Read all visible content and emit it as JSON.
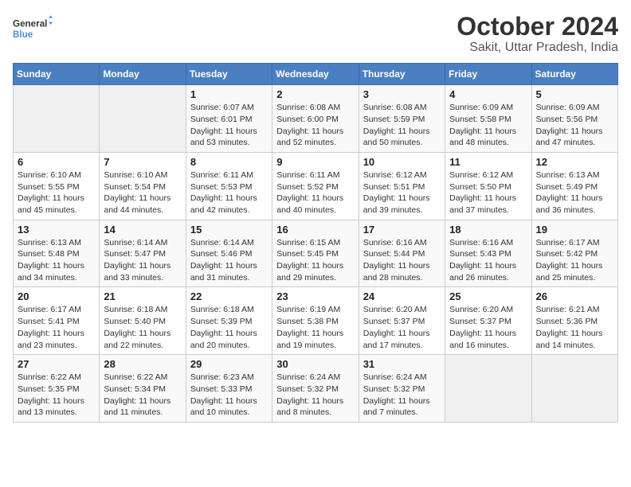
{
  "logo": {
    "text_general": "General",
    "text_blue": "Blue"
  },
  "title": "October 2024",
  "subtitle": "Sakit, Uttar Pradesh, India",
  "days_header": [
    "Sunday",
    "Monday",
    "Tuesday",
    "Wednesday",
    "Thursday",
    "Friday",
    "Saturday"
  ],
  "weeks": [
    [
      {
        "day": "",
        "info": ""
      },
      {
        "day": "",
        "info": ""
      },
      {
        "day": "1",
        "info": "Sunrise: 6:07 AM\nSunset: 6:01 PM\nDaylight: 11 hours and 53 minutes."
      },
      {
        "day": "2",
        "info": "Sunrise: 6:08 AM\nSunset: 6:00 PM\nDaylight: 11 hours and 52 minutes."
      },
      {
        "day": "3",
        "info": "Sunrise: 6:08 AM\nSunset: 5:59 PM\nDaylight: 11 hours and 50 minutes."
      },
      {
        "day": "4",
        "info": "Sunrise: 6:09 AM\nSunset: 5:58 PM\nDaylight: 11 hours and 48 minutes."
      },
      {
        "day": "5",
        "info": "Sunrise: 6:09 AM\nSunset: 5:56 PM\nDaylight: 11 hours and 47 minutes."
      }
    ],
    [
      {
        "day": "6",
        "info": "Sunrise: 6:10 AM\nSunset: 5:55 PM\nDaylight: 11 hours and 45 minutes."
      },
      {
        "day": "7",
        "info": "Sunrise: 6:10 AM\nSunset: 5:54 PM\nDaylight: 11 hours and 44 minutes."
      },
      {
        "day": "8",
        "info": "Sunrise: 6:11 AM\nSunset: 5:53 PM\nDaylight: 11 hours and 42 minutes."
      },
      {
        "day": "9",
        "info": "Sunrise: 6:11 AM\nSunset: 5:52 PM\nDaylight: 11 hours and 40 minutes."
      },
      {
        "day": "10",
        "info": "Sunrise: 6:12 AM\nSunset: 5:51 PM\nDaylight: 11 hours and 39 minutes."
      },
      {
        "day": "11",
        "info": "Sunrise: 6:12 AM\nSunset: 5:50 PM\nDaylight: 11 hours and 37 minutes."
      },
      {
        "day": "12",
        "info": "Sunrise: 6:13 AM\nSunset: 5:49 PM\nDaylight: 11 hours and 36 minutes."
      }
    ],
    [
      {
        "day": "13",
        "info": "Sunrise: 6:13 AM\nSunset: 5:48 PM\nDaylight: 11 hours and 34 minutes."
      },
      {
        "day": "14",
        "info": "Sunrise: 6:14 AM\nSunset: 5:47 PM\nDaylight: 11 hours and 33 minutes."
      },
      {
        "day": "15",
        "info": "Sunrise: 6:14 AM\nSunset: 5:46 PM\nDaylight: 11 hours and 31 minutes."
      },
      {
        "day": "16",
        "info": "Sunrise: 6:15 AM\nSunset: 5:45 PM\nDaylight: 11 hours and 29 minutes."
      },
      {
        "day": "17",
        "info": "Sunrise: 6:16 AM\nSunset: 5:44 PM\nDaylight: 11 hours and 28 minutes."
      },
      {
        "day": "18",
        "info": "Sunrise: 6:16 AM\nSunset: 5:43 PM\nDaylight: 11 hours and 26 minutes."
      },
      {
        "day": "19",
        "info": "Sunrise: 6:17 AM\nSunset: 5:42 PM\nDaylight: 11 hours and 25 minutes."
      }
    ],
    [
      {
        "day": "20",
        "info": "Sunrise: 6:17 AM\nSunset: 5:41 PM\nDaylight: 11 hours and 23 minutes."
      },
      {
        "day": "21",
        "info": "Sunrise: 6:18 AM\nSunset: 5:40 PM\nDaylight: 11 hours and 22 minutes."
      },
      {
        "day": "22",
        "info": "Sunrise: 6:18 AM\nSunset: 5:39 PM\nDaylight: 11 hours and 20 minutes."
      },
      {
        "day": "23",
        "info": "Sunrise: 6:19 AM\nSunset: 5:38 PM\nDaylight: 11 hours and 19 minutes."
      },
      {
        "day": "24",
        "info": "Sunrise: 6:20 AM\nSunset: 5:37 PM\nDaylight: 11 hours and 17 minutes."
      },
      {
        "day": "25",
        "info": "Sunrise: 6:20 AM\nSunset: 5:37 PM\nDaylight: 11 hours and 16 minutes."
      },
      {
        "day": "26",
        "info": "Sunrise: 6:21 AM\nSunset: 5:36 PM\nDaylight: 11 hours and 14 minutes."
      }
    ],
    [
      {
        "day": "27",
        "info": "Sunrise: 6:22 AM\nSunset: 5:35 PM\nDaylight: 11 hours and 13 minutes."
      },
      {
        "day": "28",
        "info": "Sunrise: 6:22 AM\nSunset: 5:34 PM\nDaylight: 11 hours and 11 minutes."
      },
      {
        "day": "29",
        "info": "Sunrise: 6:23 AM\nSunset: 5:33 PM\nDaylight: 11 hours and 10 minutes."
      },
      {
        "day": "30",
        "info": "Sunrise: 6:24 AM\nSunset: 5:32 PM\nDaylight: 11 hours and 8 minutes."
      },
      {
        "day": "31",
        "info": "Sunrise: 6:24 AM\nSunset: 5:32 PM\nDaylight: 11 hours and 7 minutes."
      },
      {
        "day": "",
        "info": ""
      },
      {
        "day": "",
        "info": ""
      }
    ]
  ]
}
